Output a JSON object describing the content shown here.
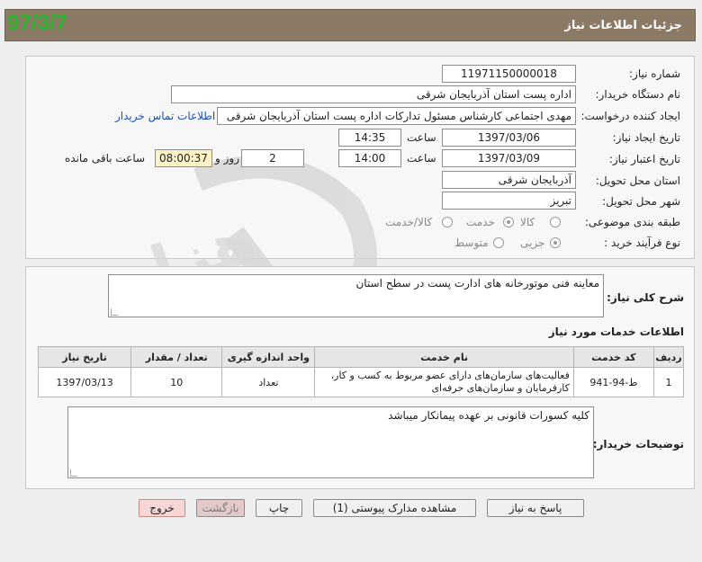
{
  "header": {
    "title": "جزئیات اطلاعات نیاز",
    "date_stamp": "97/3/7"
  },
  "form": {
    "need_number_label": "شماره نیاز:",
    "need_number": "11971150000018",
    "buyer_org_label": "نام دستگاه خریدار:",
    "buyer_org": "اداره پست استان آذربایجان شرقی",
    "creator_label": "ایجاد کننده درخواست:",
    "creator": "مهدی اجتماعی کارشناس مسئول تدارکات اداره پست استان آذربایجان شرقی",
    "contact_link": "اطلاعات تماس خریدار",
    "created_date_label": "تاریخ ایجاد نیاز:",
    "created_date": "1397/03/06",
    "time_label": "ساعت",
    "created_time": "14:35",
    "validity_label": "تاریخ اعتبار نیاز:",
    "validity_date": "1397/03/09",
    "validity_time": "14:00",
    "days_value": "2",
    "days_label": "روز و",
    "remaining_time": "08:00:37",
    "remaining_label": "ساعت باقی مانده",
    "province_label": "استان محل تحویل:",
    "province": "آذربایجان شرقی",
    "city_label": "شهر محل تحویل:",
    "city": "تبریز",
    "category_label": "طبقه بندی موضوعی:",
    "category_options": [
      "کالا",
      "خدمت",
      "کالا/خدمت"
    ],
    "category_selected": "خدمت",
    "process_label": "نوع فرآیند خرید :",
    "process_options": [
      "جزیی",
      "متوسط"
    ],
    "process_selected": "جزیی"
  },
  "description": {
    "label": "شرح کلی نیاز:",
    "text": "معاینه فنی موتورخانه های ادارت پست در سطح استان"
  },
  "services": {
    "section_title": "اطلاعات خدمات مورد نیاز",
    "columns": [
      "ردیف",
      "کد خدمت",
      "نام خدمت",
      "واحد اندازه گیری",
      "تعداد / مقدار",
      "تاریخ نیاز"
    ],
    "rows": [
      {
        "row": "1",
        "code": "ط-94-941",
        "name": "فعالیت‌های سازمان‌های دارای عضو مربوط به کسب و کار، کارفرمایان و سازمان‌های حرفه‌ای",
        "unit": "تعداد",
        "qty": "10",
        "date": "1397/03/13"
      }
    ]
  },
  "buyer_notes": {
    "label": "توضیحات خریدار:",
    "text": "کلیه کسورات قانونی بر عهده پیمانکار میباشد"
  },
  "buttons": {
    "reply": "پاسخ به نیاز",
    "attachments": "مشاهده مدارک پیوستی (1)",
    "print": "چاپ",
    "back": "بازگشت",
    "exit": "خروج"
  }
}
